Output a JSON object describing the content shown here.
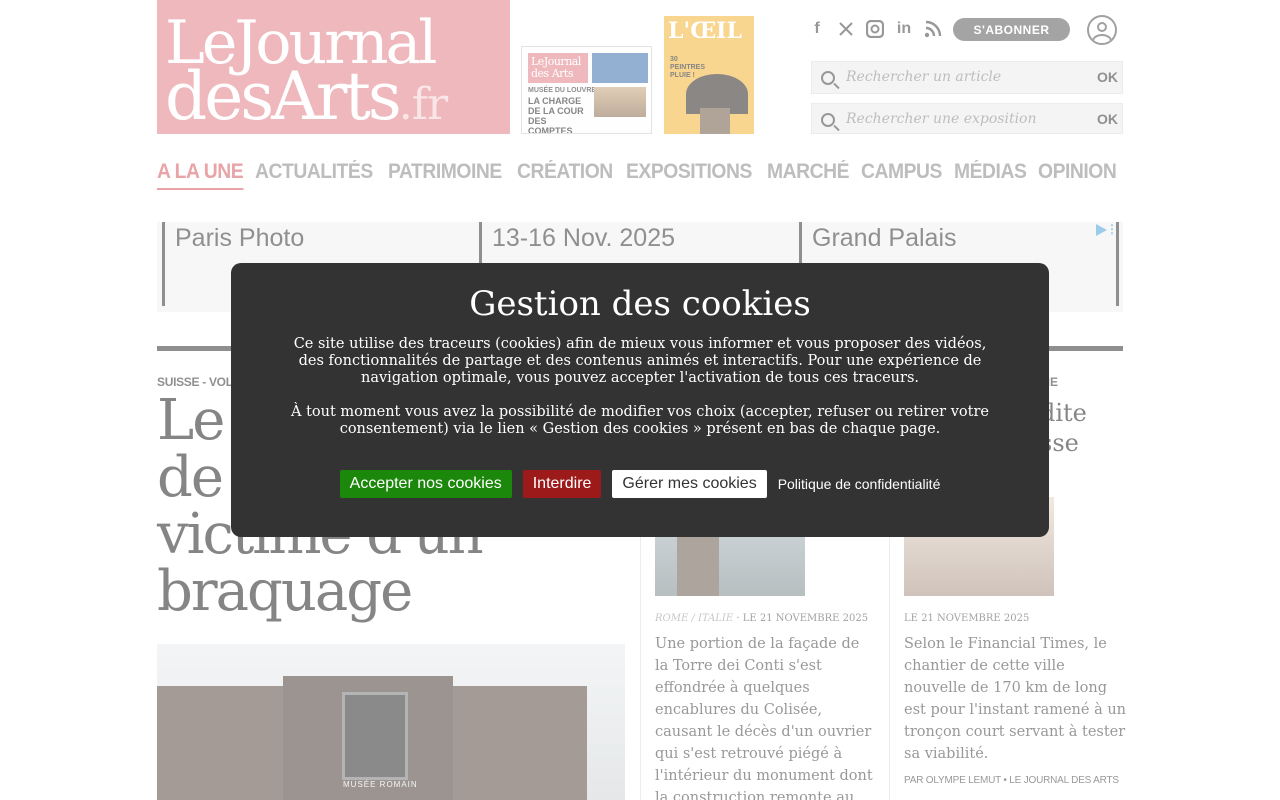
{
  "header": {
    "logo_line1": "LeJournal",
    "logo_line2": "desArts",
    "logo_tld": ".fr",
    "subscribe_label": "S'ABONNER",
    "search_article_placeholder": "Rechercher un article",
    "search_exhibition_placeholder": "Rechercher une exposition",
    "ok_label": "OK"
  },
  "magazines": {
    "jda": {
      "logo": "LeJournal des Arts",
      "line": "MUSÉE DU LOUVRE",
      "headline": "LA CHARGE DE LA COUR DES COMPTES"
    },
    "oeil": {
      "logo": "L'ŒIL",
      "sub": "30 PEINTRES PLUIE !"
    }
  },
  "nav": {
    "items": [
      {
        "label": "A LA UNE",
        "active": true
      },
      {
        "label": "ACTUALITÉS"
      },
      {
        "label": "PATRIMOINE"
      },
      {
        "label": "CRÉATION"
      },
      {
        "label": "EXPOSITIONS"
      },
      {
        "label": "MARCHÉ"
      },
      {
        "label": "CAMPUS"
      },
      {
        "label": "MÉDIAS"
      },
      {
        "label": "OPINION"
      }
    ]
  },
  "ad": {
    "seg1": "Paris Photo",
    "seg2": "13-16 Nov. 2025",
    "seg3": "Grand Palais"
  },
  "main_article": {
    "kicker": "SUISSE - VOL",
    "title": "Le musée romain de Lausanne victime d'un braquage",
    "photo_sign": "MUSÉE ROMAIN"
  },
  "article2": {
    "location": "ROME / ITALIE",
    "date": "LE 21 NOVEMBRE 2025",
    "text": "Une portion de la façade de la Torre dei Conti s'est effondrée à quelques encablures du Colisée, causant le décès d'un ouvrier qui s'est retrouvé piégé à l'intérieur du monument dont la construction remonte au XIIIe"
  },
  "article3": {
    "kicker": "ME",
    "title_fragment": "dite\nsse",
    "date": "LE 21 NOVEMBRE 2025",
    "text": "Selon le Financial Times, le chantier de cette ville nouvelle de 170 km de long est pour l'instant ramené à un tronçon court servant à tester sa viabilité.",
    "byline": "PAR OLYMPE LEMUT • LE JOURNAL DES ARTS"
  },
  "cookie_modal": {
    "title": "Gestion des cookies",
    "text1": "Ce site utilise des traceurs (cookies) afin de mieux vous informer et vous proposer des vidéos, des fonctionnalités de partage et des contenus animés et interactifs. Pour une expérience de navigation optimale, vous pouvez accepter l'activation de tous ces traceurs.",
    "text2": "À tout moment vous avez la possibilité de modifier vos choix (accepter, refuser ou retirer votre consentement) via le lien « Gestion des cookies » présent en bas de chaque page.",
    "accept_label": "Accepter nos cookies",
    "deny_label": "Interdire",
    "manage_label": "Gérer mes cookies",
    "policy_label": "Politique de confidentialité"
  },
  "colors": {
    "brand_pink": "#e07f86",
    "nav_active": "#d8595f",
    "modal_bg": "#333333",
    "accept_green": "#1b870b",
    "deny_red": "#9c1a1a"
  },
  "icons": [
    "facebook-icon",
    "x-icon",
    "instagram-icon",
    "linkedin-icon",
    "rss-icon",
    "user-icon",
    "search-icon"
  ]
}
